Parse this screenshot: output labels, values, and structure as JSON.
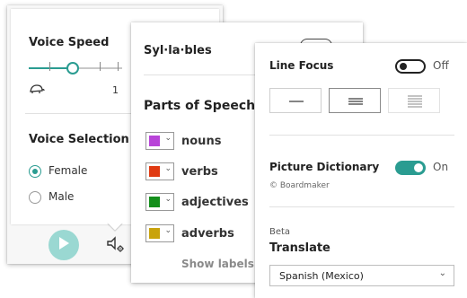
{
  "panel_voice": {
    "voice_speed_title": "Voice Speed",
    "slider_value_label": "1",
    "slider_level_fraction": 0.46,
    "voice_selection_title": "Voice Selection",
    "options": [
      {
        "label": "Female",
        "selected": true
      },
      {
        "label": "Male",
        "selected": false
      }
    ],
    "icons": [
      "turtle-icon",
      "play-icon",
      "settings-speaker-icon"
    ],
    "accent_color": "#2a9c91",
    "play_color": "#9ad8d2"
  },
  "panel_grammar": {
    "syllables_label": "Syl·la·bles",
    "parts_of_speech_title": "Parts of Speech",
    "parts": [
      {
        "label": "nouns",
        "color": "#b844d8"
      },
      {
        "label": "verbs",
        "color": "#e03a12"
      },
      {
        "label": "adjectives",
        "color": "#148f1b"
      },
      {
        "label": "adverbs",
        "color": "#c9a30c"
      }
    ],
    "show_labels": "Show labels"
  },
  "panel_reading": {
    "line_focus_label": "Line Focus",
    "line_focus_state": "Off",
    "picture_dictionary_label": "Picture Dictionary",
    "picture_dictionary_state": "On",
    "credit": "© Boardmaker",
    "beta_label": "Beta",
    "translate_label": "Translate",
    "language_value": "Spanish (Mexico)"
  }
}
